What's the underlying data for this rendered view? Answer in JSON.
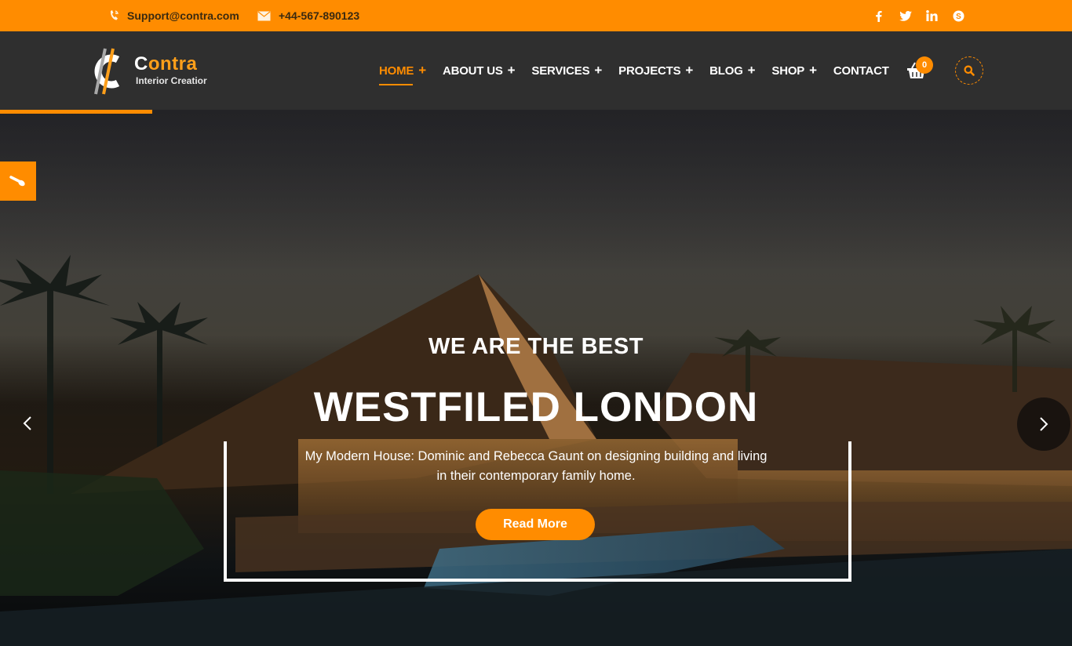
{
  "topbar": {
    "email": "Support@contra.com",
    "phone": "+44-567-890123",
    "socials": [
      {
        "name": "facebook",
        "glyph": "f"
      },
      {
        "name": "twitter",
        "glyph": "t"
      },
      {
        "name": "linkedin",
        "glyph": "in"
      },
      {
        "name": "skype",
        "glyph": "S"
      }
    ]
  },
  "brand": {
    "name_first": "C",
    "name_rest": "ontra",
    "tagline": "Interior Creatior",
    "accent": "#ff8c00"
  },
  "nav": {
    "items": [
      {
        "label": "HOME",
        "has_submenu": true,
        "active": true
      },
      {
        "label": "ABOUT US",
        "has_submenu": true,
        "active": false
      },
      {
        "label": "SERVICES",
        "has_submenu": true,
        "active": false
      },
      {
        "label": "PROJECTS",
        "has_submenu": true,
        "active": false
      },
      {
        "label": "BLOG",
        "has_submenu": true,
        "active": false
      },
      {
        "label": "SHOP",
        "has_submenu": true,
        "active": false
      },
      {
        "label": "CONTACT",
        "has_submenu": false,
        "active": false
      }
    ],
    "submenu_marker": "+",
    "cart_count": "0"
  },
  "hero": {
    "subtitle": "WE ARE THE BEST",
    "title": "WESTFILED LONDON",
    "description": "My Modern House: Dominic and Rebecca Gaunt on designing building and living in their contemporary family home.",
    "cta_label": "Read More"
  },
  "icons": {
    "phone": "phone-icon",
    "email": "envelope-icon",
    "cart": "shopping-basket-icon",
    "search": "search-icon",
    "side_tab": "paint-brush-icon",
    "prev": "chevron-left-icon",
    "next": "chevron-right-icon"
  }
}
